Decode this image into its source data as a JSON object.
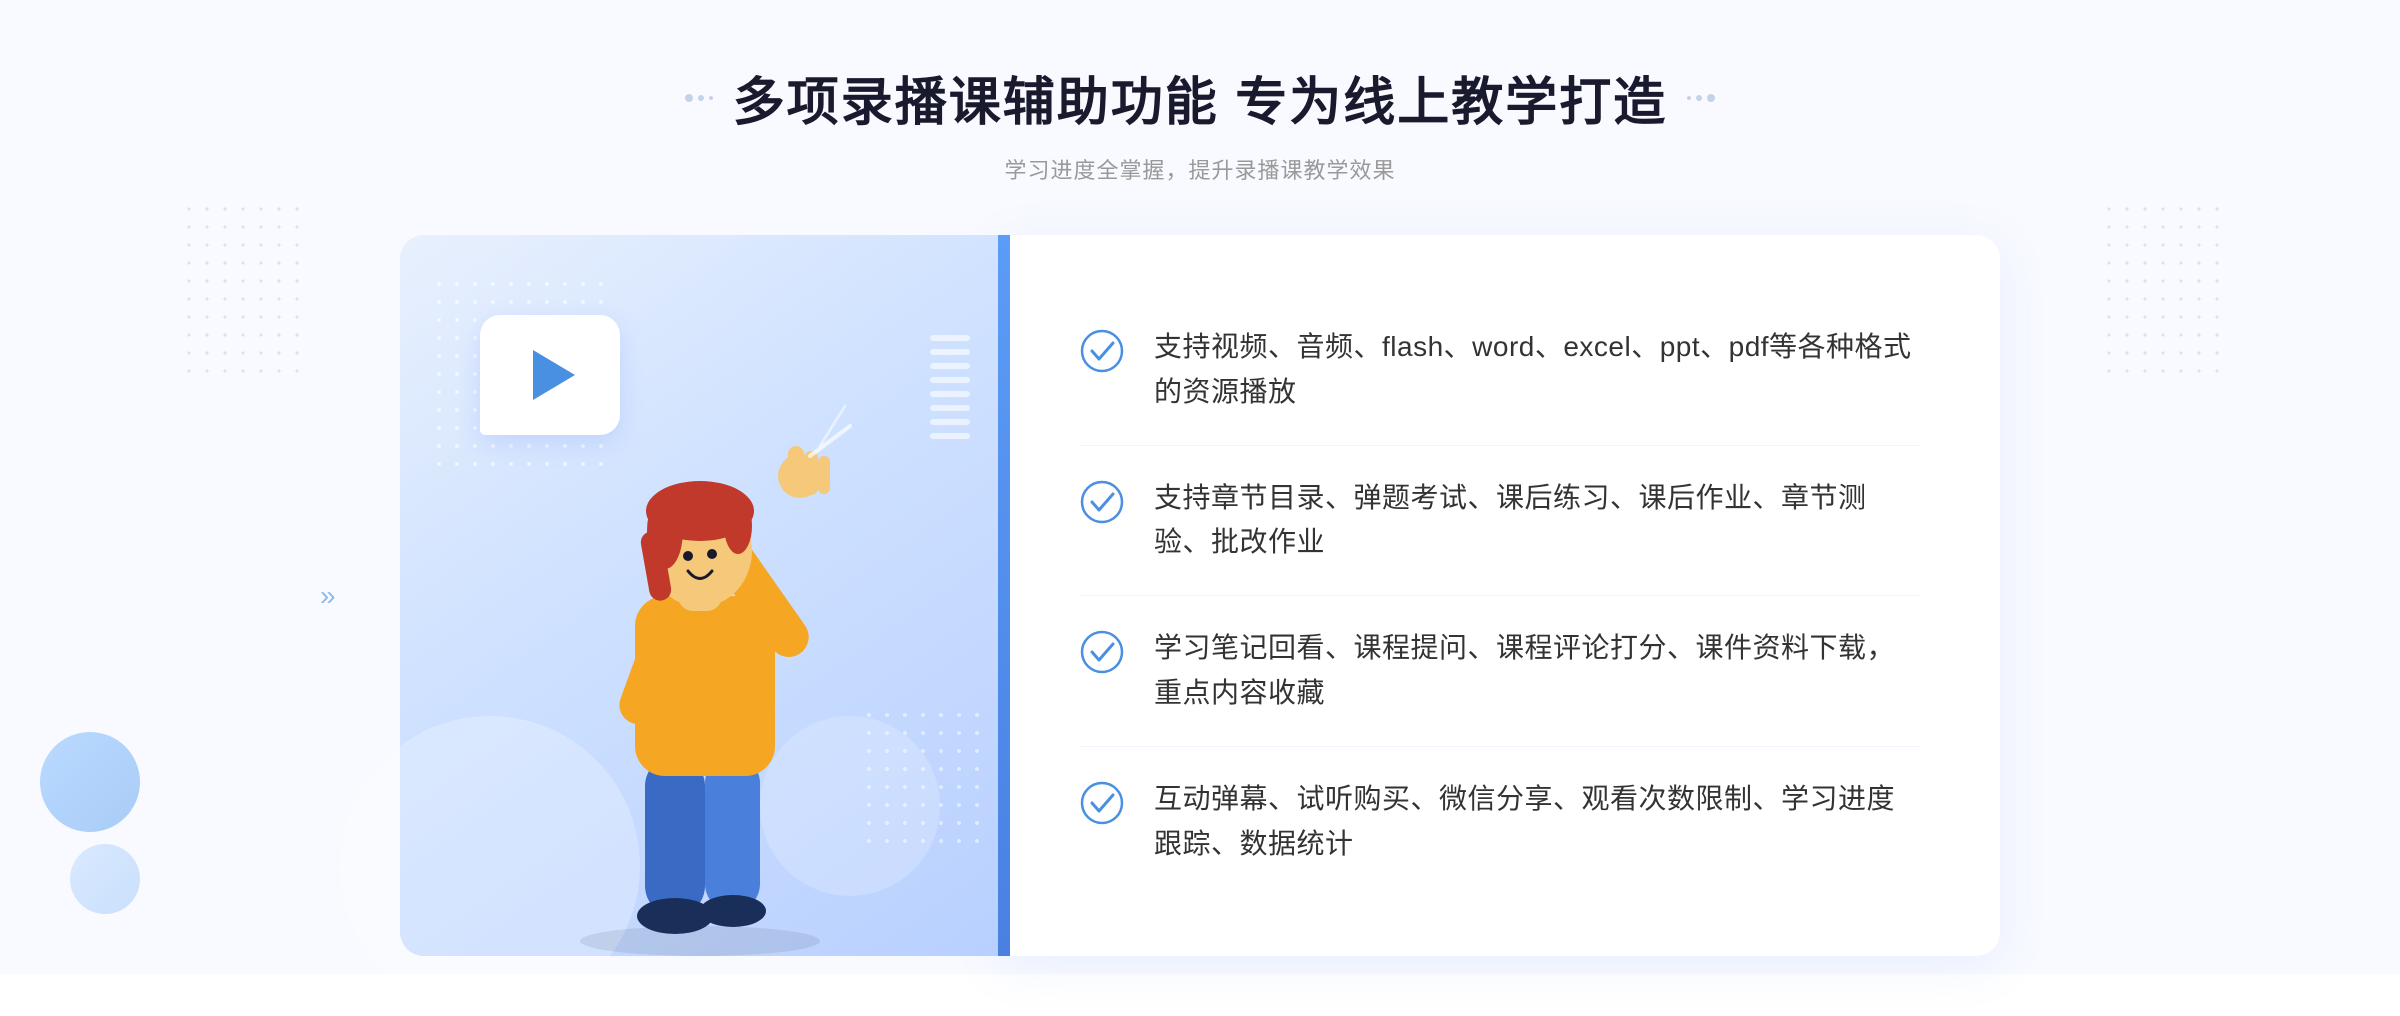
{
  "header": {
    "main_title": "多项录播课辅助功能 专为线上教学打造",
    "sub_title": "学习进度全掌握，提升录播课教学效果"
  },
  "features": [
    {
      "id": 1,
      "text": "支持视频、音频、flash、word、excel、ppt、pdf等各种格式的资源播放"
    },
    {
      "id": 2,
      "text": "支持章节目录、弹题考试、课后练习、课后作业、章节测验、批改作业"
    },
    {
      "id": 3,
      "text": "学习笔记回看、课程提问、课程评论打分、课件资料下载，重点内容收藏"
    },
    {
      "id": 4,
      "text": "互动弹幕、试听购买、微信分享、观看次数限制、学习进度跟踪、数据统计"
    }
  ],
  "colors": {
    "accent": "#4a90e2",
    "title_color": "#1a1a2e",
    "subtitle_color": "#999999",
    "text_color": "#333333",
    "check_color": "#4a90e2",
    "bg_light": "#f8faff"
  },
  "icons": {
    "check": "check-circle-icon",
    "play": "play-icon",
    "chevron": "chevron-right-icon"
  }
}
